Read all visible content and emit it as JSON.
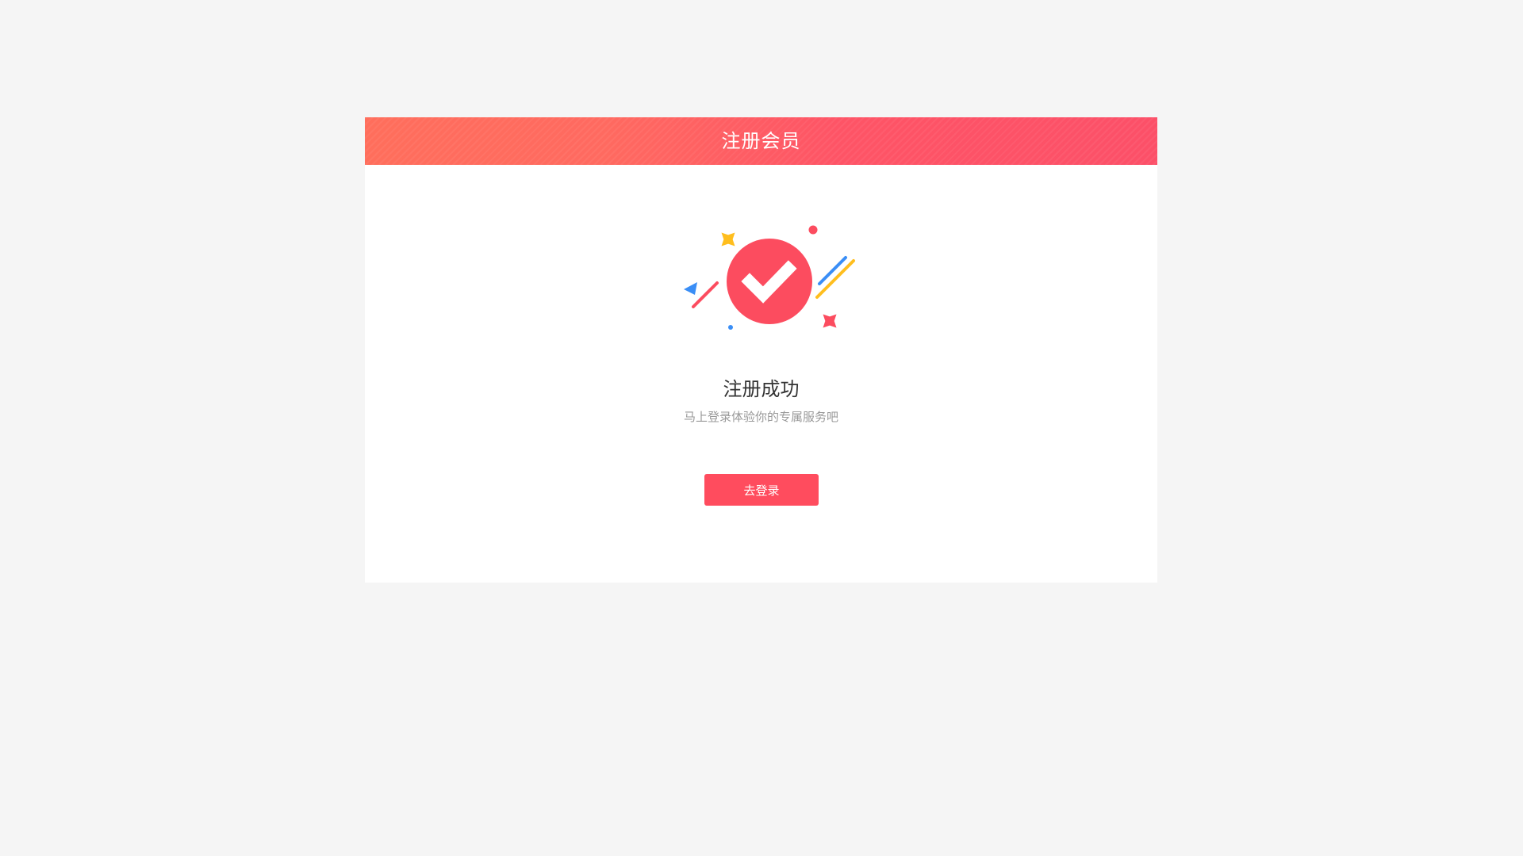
{
  "header": {
    "title": "注册会员"
  },
  "result": {
    "title": "注册成功",
    "subtitle": "马上登录体验你的专属服务吧",
    "icon": "success-check-icon"
  },
  "actions": {
    "login_label": "去登录"
  },
  "colors": {
    "accent": "#ff4c5e",
    "header_start": "#ff6e5c",
    "header_end": "#fc5068",
    "page_background": "#f5f5f5"
  }
}
